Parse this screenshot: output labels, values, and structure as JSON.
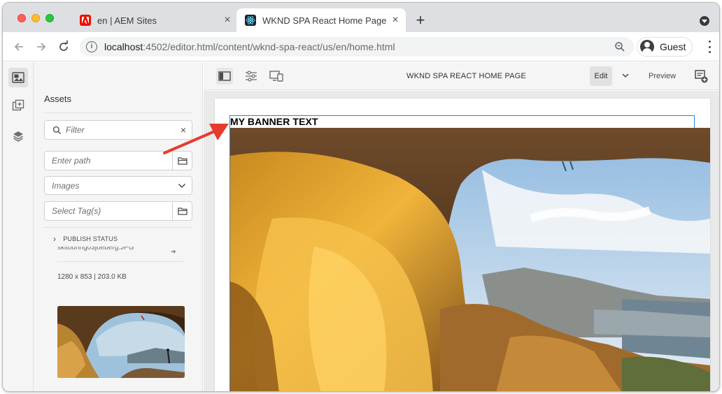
{
  "browser": {
    "tabs": [
      {
        "title": "en | AEM Sites",
        "active": false
      },
      {
        "title": "WKND SPA React Home Page",
        "active": true
      }
    ],
    "new_tab_label": "+",
    "address": {
      "host": "localhost",
      "path": ":4502/editor.html/content/wknd-spa-react/us/en/home.html"
    },
    "profile_label": "Guest"
  },
  "side_panel": {
    "title": "Assets",
    "filter_placeholder": "Filter",
    "path_placeholder": "Enter path",
    "type_select": "Images",
    "tags_placeholder": "Select Tag(s)",
    "publish_status": "PUBLISH STATUS",
    "asset_name": "skitouring03joeberg.JPG",
    "asset_info": "1280 x 853 | 203.0 KB"
  },
  "editor": {
    "page_title": "WKND SPA REACT HOME PAGE",
    "edit_label": "Edit",
    "preview_label": "Preview"
  },
  "content": {
    "banner_text": "MY BANNER TEXT"
  },
  "colors": {
    "selection_outline": "#2680eb",
    "annotation_arrow": "#e63c2d",
    "tab_strip": "#dedfe3"
  }
}
